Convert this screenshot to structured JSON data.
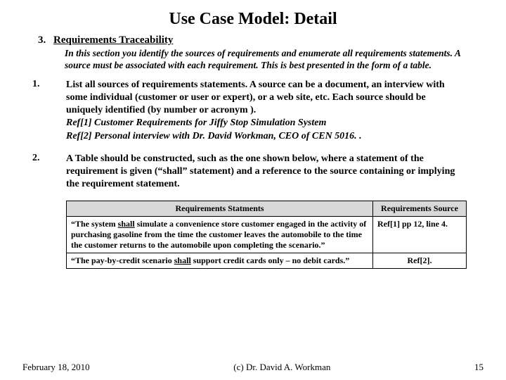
{
  "title": "Use Case Model: Detail",
  "section": {
    "number": "3.",
    "heading": "Requirements Traceability",
    "intro": "In this section you identify the sources of requirements and enumerate all requirements statements.  A source must be associated with each requirement. This is best presented in the form of a table."
  },
  "items": [
    {
      "num": "1.",
      "text": "List all sources of requirements statements.  A source can be a document, an interview with some individual (customer or user or expert), or a web site, etc.  Each source should be uniquely identified (by number or acronym ).",
      "refs": "Ref[1]  Customer Requirements for Jiffy Stop Simulation System\nRef[2]  Personal interview with Dr. David Workman, CEO of CEN 5016. ."
    },
    {
      "num": "2.",
      "text": "A Table should be constructed, such as the one shown below, where a statement of the requirement is given (“shall” statement) and a reference to the source containing or implying the requirement statement.",
      "refs": ""
    }
  ],
  "table": {
    "headers": {
      "stmt": "Requirements Statments",
      "src": "Requirements Source"
    },
    "rows": [
      {
        "pre": "“The system ",
        "shall": "shall",
        "post": " simulate a convenience store customer  engaged in the activity of purchasing gasoline from the time the customer leaves the automobile to the time the customer returns to the automobile upon completing the scenario.”",
        "src": "Ref[1] pp 12, line 4."
      },
      {
        "pre": "“The pay-by-credit scenario ",
        "shall": "shall",
        "post": " support credit cards only – no debit cards.”",
        "src": "Ref[2]."
      }
    ]
  },
  "footer": {
    "date": "February 18, 2010",
    "copyright": "(c) Dr. David A. Workman",
    "page": "15"
  }
}
